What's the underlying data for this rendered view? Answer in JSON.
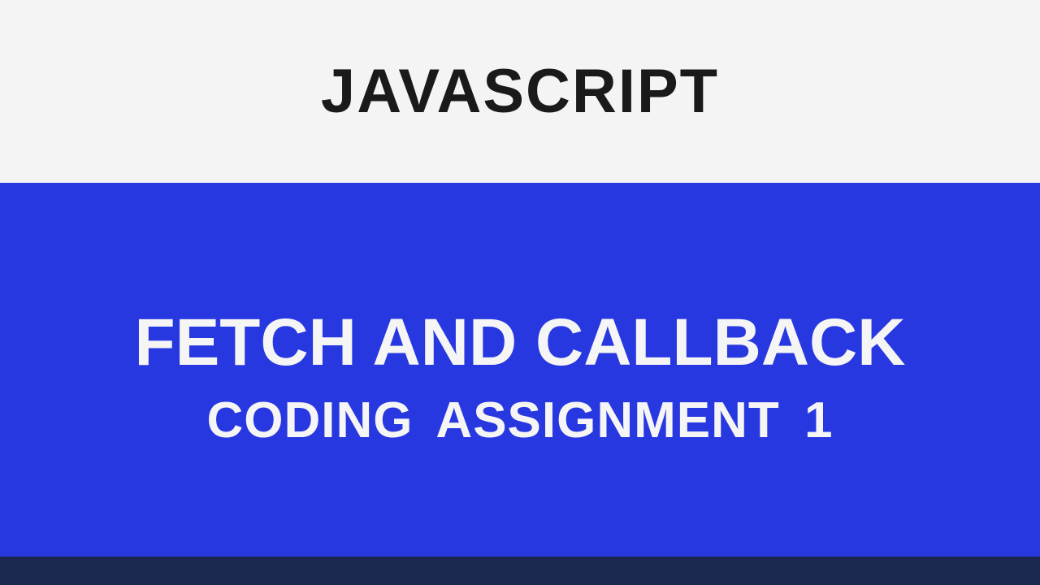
{
  "header": {
    "title": "JAVASCRIPT"
  },
  "main": {
    "title": "FETCH AND CALLBACK",
    "subtitle": "CODING ASSIGNMENT 1"
  },
  "colors": {
    "background": "#f4f4f4",
    "primary": "#2838e0",
    "dark_accent": "#1a2850",
    "text_dark": "#1a1a1a",
    "text_light": "#f5f5f5"
  }
}
